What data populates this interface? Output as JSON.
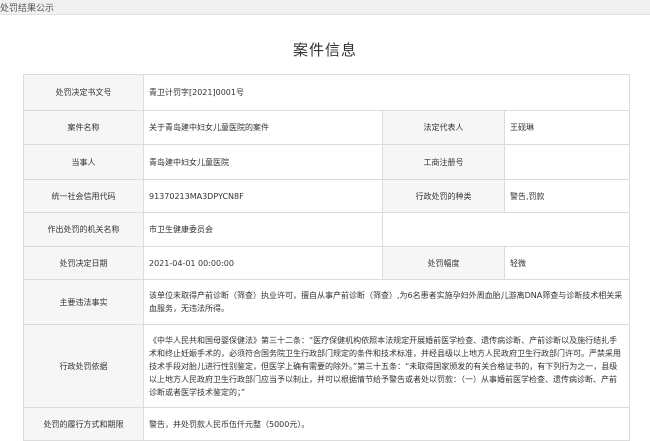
{
  "header": {
    "breadcrumb": "处罚结果公示"
  },
  "page_title": "案件信息",
  "labels": {
    "doc_number": "处罚决定书文号",
    "case_name": "案件名称",
    "legal_rep": "法定代表人",
    "party": "当事人",
    "business_reg": "工商注册号",
    "credit_code": "统一社会信用代码",
    "penalty_type": "行政处罚的种类",
    "authority": "作出处罚的机关名称",
    "decision_date": "处罚决定日期",
    "penalty_degree": "处罚幅度",
    "violations": "主要违法事实",
    "legal_basis": "行政处罚依据",
    "execution": "处罚的履行方式和期限"
  },
  "values": {
    "doc_number": "青卫计罚字[2021]0001号",
    "case_name": "关于青岛建中妇女儿童医院的案件",
    "legal_rep": "王砚琳",
    "party": "青岛建中妇女儿童医院",
    "business_reg": "",
    "credit_code": "91370213MA3DPYCN8F",
    "penalty_type": "警告,罚款",
    "authority": "市卫生健康委员会",
    "decision_date": "2021-04-01 00:00:00",
    "penalty_degree": "轻微",
    "violations": "该单位未取得产前诊断（筛查）执业许可，擅自从事产前诊断（筛查）,为6名患者实施孕妇外周血胎儿游离DNA筛查与诊断技术相关采血服务，无违法所得。",
    "legal_basis": "《中华人民共和国母婴保健法》第三十二条：“医疗保健机构依照本法规定开展婚前医学检查、遗传病诊断、产前诊断以及施行结扎手术和终止妊娠手术的，必须符合国务院卫生行政部门规定的条件和技术标准，并经县级以上地方人民政府卫生行政部门许可。严禁采用技术手段对胎儿进行性别鉴定，但医学上确有需要的除外。”第三十五条：“未取得国家颁发的有关合格证书的，有下列行为之一，县级以上地方人民政府卫生行政部门应当予以制止，并可以根据情节给予警告或者处以罚款：（一）从事婚前医学检查、遗传病诊断、产前诊断或者医学技术鉴定的；”",
    "execution": "警告，并处罚款人民币伍仟元整（5000元）。"
  }
}
